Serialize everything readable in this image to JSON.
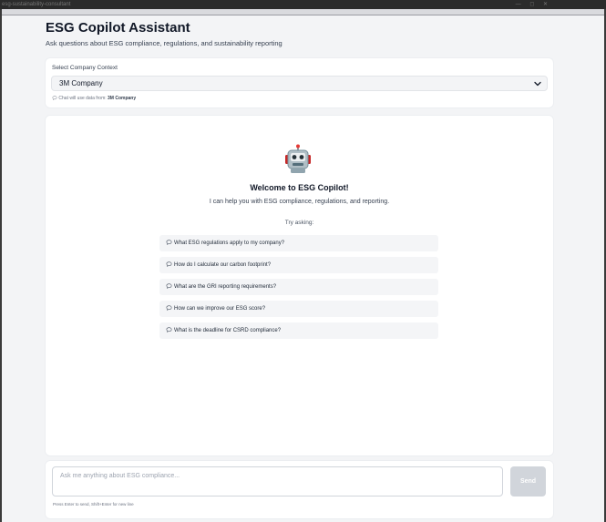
{
  "window": {
    "tab_text": "esg-sustainability-consultant",
    "controls": "— ◻ ✕"
  },
  "header": {
    "title": "ESG Copilot Assistant",
    "subtitle": "Ask questions about ESG compliance, regulations, and sustainability reporting"
  },
  "context": {
    "label": "Select Company Context",
    "selected": "3M Company",
    "note_prefix": "Chat will use data from:",
    "note_company": "3M Company"
  },
  "chat": {
    "welcome_title": "Welcome to ESG Copilot!",
    "welcome_subtitle": "I can help you with ESG compliance, regulations, and reporting.",
    "try_label": "Try asking:",
    "suggestions": [
      "What ESG regulations apply to my company?",
      "How do I calculate our carbon footprint?",
      "What are the GRI reporting requirements?",
      "How can we improve our ESG score?",
      "What is the deadline for CSRD compliance?"
    ]
  },
  "composer": {
    "placeholder": "Ask me anything about ESG compliance...",
    "send_label": "Send",
    "hint": "Press Enter to send, Shift+Enter for new line"
  },
  "colors": {
    "page_bg": "#f3f4f6",
    "card_bg": "#ffffff",
    "send_disabled": "#d1d5db"
  },
  "icons": {
    "robot": "robot-icon",
    "chat_bubble": "chat-bubble-icon",
    "chevron": "chevron-down-icon"
  }
}
